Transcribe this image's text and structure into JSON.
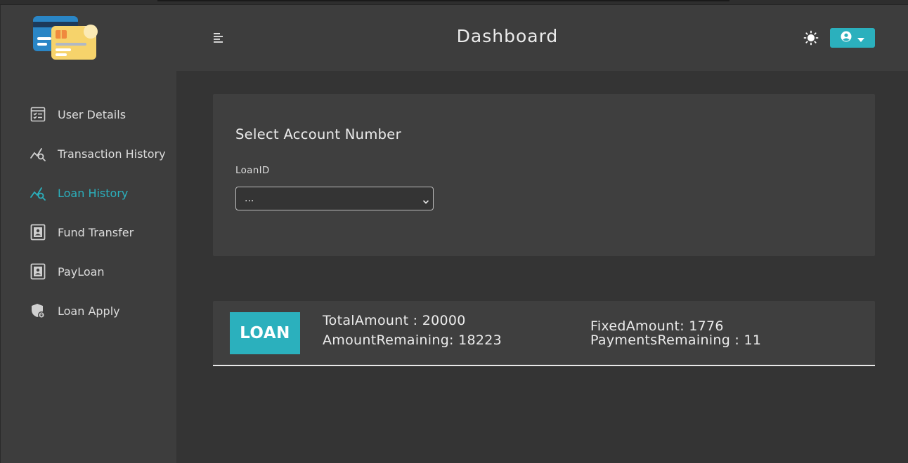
{
  "header": {
    "title": "Dashboard",
    "menu_icon": "hamburger-icon",
    "theme_icon": "sun-icon",
    "user_icon": "user-circle-icon"
  },
  "sidebar": {
    "logo": "credit-cards-logo",
    "items": [
      {
        "label": "User Details",
        "icon": "user-details-icon",
        "active": false
      },
      {
        "label": "Transaction History",
        "icon": "chart-search-icon",
        "active": false
      },
      {
        "label": "Loan History",
        "icon": "chart-search-icon",
        "active": true
      },
      {
        "label": "Fund Transfer",
        "icon": "contact-card-icon",
        "active": false
      },
      {
        "label": "PayLoan",
        "icon": "contact-card-icon",
        "active": false
      },
      {
        "label": "Loan Apply",
        "icon": "shield-lock-icon",
        "active": false
      }
    ]
  },
  "account_card": {
    "title": "Select Account Number",
    "field_label": "LoanID",
    "select_value": "..."
  },
  "loan": {
    "badge": "LOAN",
    "total_amount": "TotalAmount : 20000",
    "amount_remaining": "AmountRemaining: 18223",
    "fixed_amount": "FixedAmount: 1776",
    "payments_remaining": "PaymentsRemaining : 11"
  },
  "colors": {
    "accent": "#2bb0bd",
    "sidebar_bg": "#3d3d3d",
    "content_bg": "#343434"
  }
}
